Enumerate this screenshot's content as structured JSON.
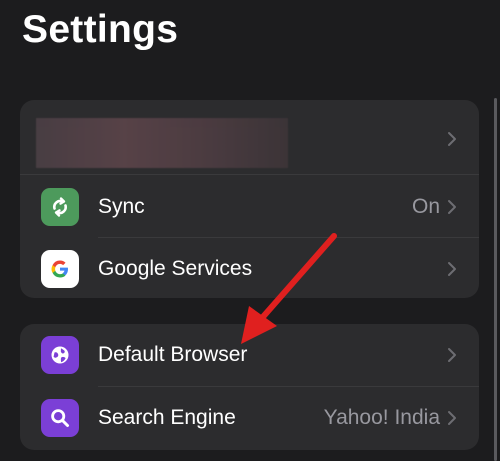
{
  "header": {
    "title": "Settings"
  },
  "groups": {
    "account": {
      "profile": {
        "name": ""
      },
      "sync": {
        "label": "Sync",
        "value": "On"
      },
      "google_services": {
        "label": "Google Services"
      }
    },
    "browser": {
      "default_browser": {
        "label": "Default Browser"
      },
      "search_engine": {
        "label": "Search Engine",
        "value": "Yahoo! India"
      }
    }
  },
  "icons": {
    "sync": "sync-icon",
    "google": "google-logo-icon",
    "default_browser": "globe-icon",
    "search_engine": "search-icon",
    "chevron": "chevron-right-icon"
  },
  "colors": {
    "background": "#1c1c1e",
    "group_background": "#2c2c2e",
    "sync_icon_bg": "#4d9a5c",
    "purple_icon_bg": "#7b3fd6",
    "annotation_arrow": "#e0201f"
  }
}
